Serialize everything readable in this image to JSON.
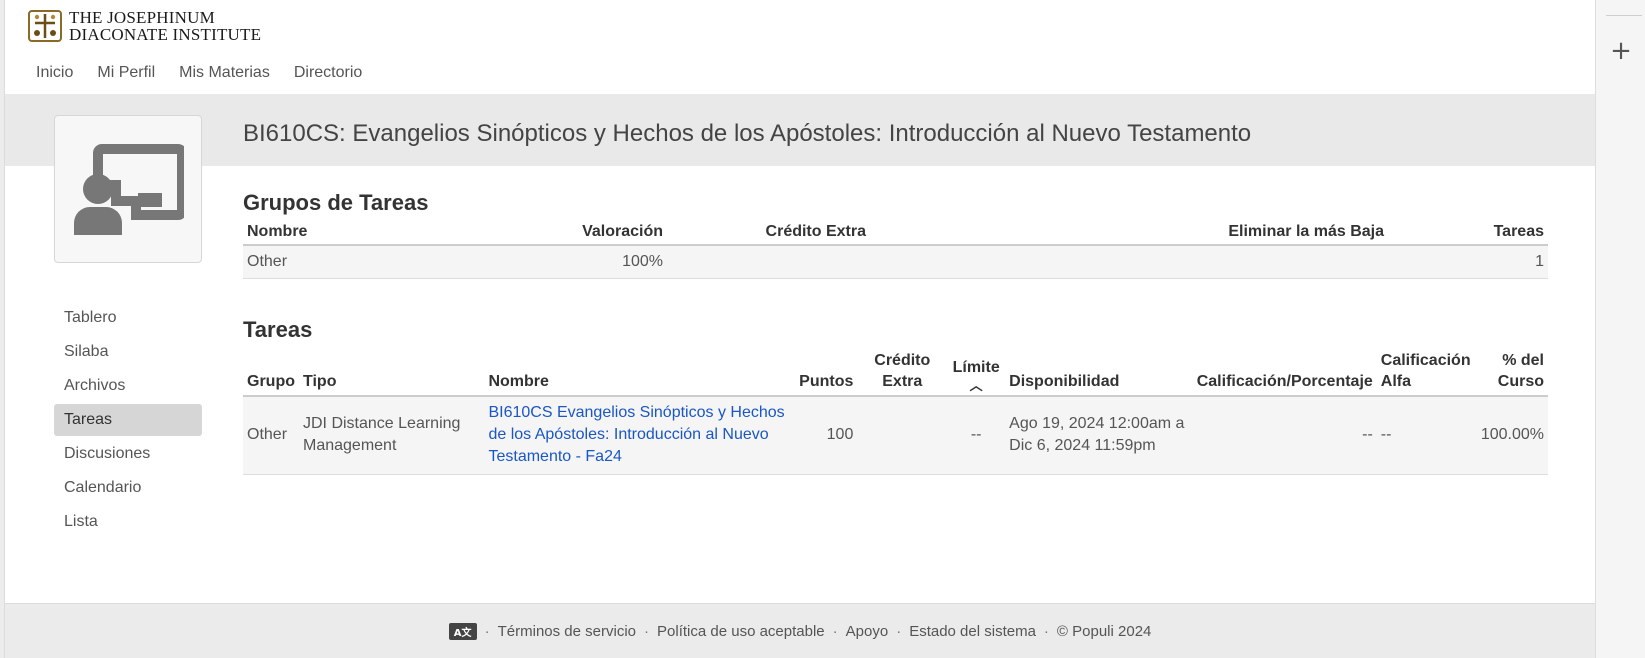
{
  "header": {
    "logo_line1": "The Josephinum",
    "logo_line2": "Diaconate Institute",
    "nav": [
      "Inicio",
      "Mi Perfil",
      "Mis Materias",
      "Directorio"
    ]
  },
  "course": {
    "title": "BI610CS: Evangelios Sinópticos y Hechos de los Apóstoles: Introducción al Nuevo Testamento"
  },
  "sidebar": {
    "items": [
      {
        "label": "Tablero"
      },
      {
        "label": "Silaba"
      },
      {
        "label": "Archivos"
      },
      {
        "label": "Tareas",
        "active": true
      },
      {
        "label": "Discusiones"
      },
      {
        "label": "Calendario"
      },
      {
        "label": "Lista"
      }
    ]
  },
  "groups": {
    "title": "Grupos de Tareas",
    "headers": [
      "Nombre",
      "Valoración",
      "Crédito Extra",
      "Eliminar la más Baja",
      "Tareas"
    ],
    "rows": [
      {
        "nombre": "Other",
        "valoracion": "100%",
        "credito": "",
        "eliminar": "",
        "tareas": "1"
      }
    ]
  },
  "tasks": {
    "title": "Tareas",
    "headers": {
      "grupo": "Grupo",
      "tipo": "Tipo",
      "nombre": "Nombre",
      "puntos": "Puntos",
      "credito": "Crédito Extra",
      "limite": "Límite",
      "disponibilidad": "Disponibilidad",
      "calificacion": "Calificación/Porcentaje",
      "alfa": "Calificación Alfa",
      "curso": "% del Curso"
    },
    "rows": [
      {
        "grupo": "Other",
        "tipo": "JDI Distance Learning Management",
        "nombre": "BI610CS Evangelios Sinópticos y Hechos de los Apóstoles: Introducción al Nuevo Testamento - Fa24",
        "puntos": "100",
        "credito": "",
        "limite": "--",
        "disponibilidad_inicio": "Ago 19, 2024 12:00am a",
        "disponibilidad_fin": "Dic 6, 2024 11:59pm",
        "calificacion": "--",
        "alfa": "--",
        "curso": "100.00%"
      }
    ]
  },
  "footer": {
    "lang_icon": "translate-icon",
    "links": [
      "Términos de servicio",
      "Política de uso aceptable",
      "Apoyo",
      "Estado del sistema"
    ],
    "copyright": "© Populi 2024"
  },
  "rail": {
    "icon": "plus-icon"
  },
  "colors": {
    "link": "#1a56c4",
    "band": "#e9e9e9",
    "active_nav": "#d6d6d6"
  }
}
